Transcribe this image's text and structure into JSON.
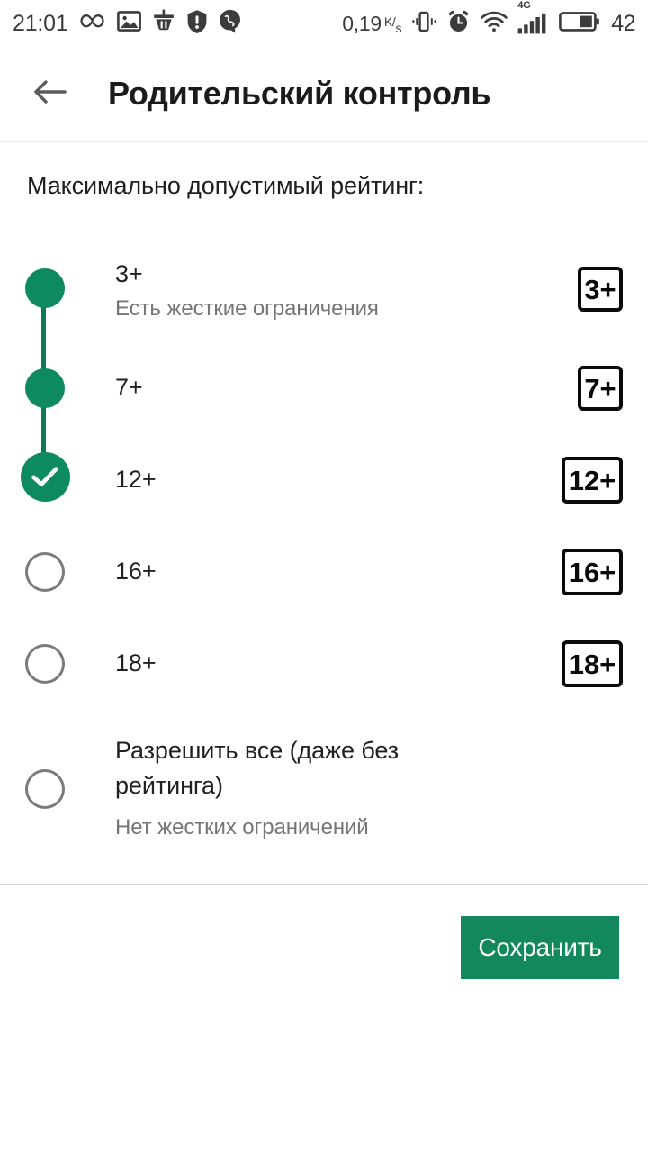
{
  "status_bar": {
    "time": "21:01",
    "left_icons": [
      "infinity-icon",
      "photo-icon",
      "cleaner-icon",
      "shield-alert-icon",
      "viber-icon"
    ],
    "network_speed_value": "0,19",
    "network_speed_unit_top": "K",
    "network_speed_unit_bottom": "s",
    "right_icons": [
      "vibrate-icon",
      "alarm-icon",
      "wifi-icon",
      "signal-icon"
    ],
    "signal_label": "4G",
    "battery_level": "42"
  },
  "app_bar": {
    "back_icon": "arrow-left-icon",
    "title": "Родительский контроль"
  },
  "content": {
    "section_label": "Максимально допустимый рейтинг:",
    "options": [
      {
        "id": "3plus",
        "title": "3+",
        "subtitle": "Есть жесткие ограничения",
        "badge": "3+",
        "badge_shape": "square",
        "state": "filled"
      },
      {
        "id": "7plus",
        "title": "7+",
        "subtitle": "",
        "badge": "7+",
        "badge_shape": "square",
        "state": "filled"
      },
      {
        "id": "12plus",
        "title": "12+",
        "subtitle": "",
        "badge": "12+",
        "badge_shape": "wide",
        "state": "checked"
      },
      {
        "id": "16plus",
        "title": "16+",
        "subtitle": "",
        "badge": "16+",
        "badge_shape": "wide",
        "state": "empty"
      },
      {
        "id": "18plus",
        "title": "18+",
        "subtitle": "",
        "badge": "18+",
        "badge_shape": "wide",
        "state": "empty"
      },
      {
        "id": "allow-all",
        "title": "Разрешить все (даже без рейтинга)",
        "subtitle": "Нет жестких ограничений",
        "badge": "",
        "badge_shape": "none",
        "state": "empty"
      }
    ]
  },
  "footer": {
    "save_label": "Сохранить"
  },
  "colors": {
    "accent_green": "#0d8a5f",
    "button_green": "#14885d",
    "track_green": "#0e7a54",
    "title_text": "#212121",
    "subtitle_text": "#767676",
    "radio_empty_border": "#7b7b7b"
  }
}
